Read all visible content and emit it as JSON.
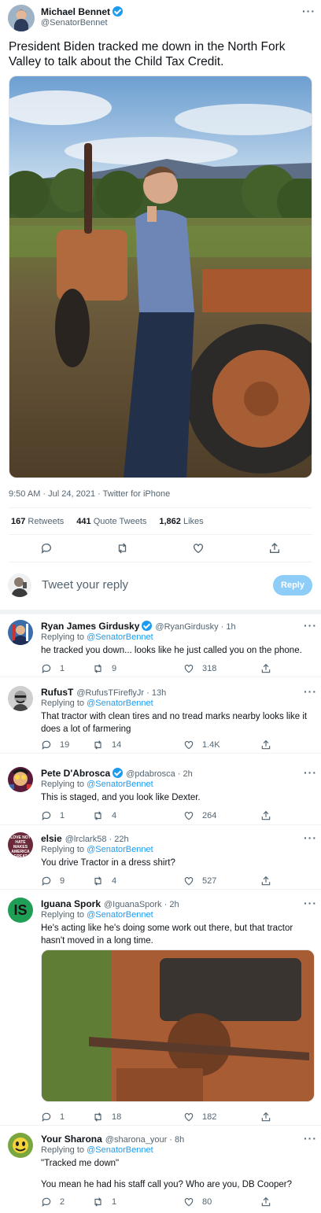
{
  "main_tweet": {
    "author_name": "Michael Bennet",
    "author_handle": "@SenatorBennet",
    "text": "President Biden tracked me down in the North Fork Valley to talk about the Child Tax Credit.",
    "timestamp": "9:50 AM · Jul 24, 2021 · Twitter for iPhone",
    "stats": {
      "retweets_count": "167",
      "retweets_label": "Retweets",
      "quotes_count": "441",
      "quotes_label": "Quote Tweets",
      "likes_count": "1,862",
      "likes_label": "Likes"
    }
  },
  "composer": {
    "placeholder": "Tweet your reply",
    "button_label": "Reply"
  },
  "replies": [
    {
      "name": "Ryan James Girdusky",
      "verified": true,
      "handle": "@RyanGirdusky · 1h",
      "replying_prefix": "Replying to",
      "replying_to": "@SenatorBennet",
      "text": "he tracked you down... looks like he just called you on the phone.",
      "replies": "1",
      "retweets": "9",
      "likes": "318"
    },
    {
      "name": "RufusT",
      "verified": false,
      "handle": "@RufusTFireflyJr · 13h",
      "replying_prefix": "Replying to",
      "replying_to": "@SenatorBennet",
      "text": "That tractor with clean tires and no tread marks nearby looks like it does a lot of farmering",
      "replies": "19",
      "retweets": "14",
      "likes": "1.4K"
    },
    {
      "name": "Pete D'Abrosca",
      "verified": true,
      "handle": "@pdabrosca · 2h",
      "replying_prefix": "Replying to",
      "replying_to": "@SenatorBennet",
      "text": "This is staged, and you look like Dexter.",
      "replies": "1",
      "retweets": "4",
      "likes": "264"
    },
    {
      "name": "elsie",
      "verified": false,
      "handle": "@lrclark58 · 22h",
      "replying_prefix": "Replying to",
      "replying_to": "@SenatorBennet",
      "text": "You drive Tractor in a dress shirt?",
      "replies": "9",
      "retweets": "4",
      "likes": "527"
    },
    {
      "name": "Iguana Spork",
      "verified": false,
      "handle": "@IguanaSpork · 2h",
      "replying_prefix": "Replying to",
      "replying_to": "@SenatorBennet",
      "text": "He's acting like he's doing some work out there, but that tractor hasn't moved in a long time.",
      "replies": "1",
      "retweets": "18",
      "likes": "182"
    },
    {
      "name": "Your Sharona",
      "verified": false,
      "handle": "@sharona_your · 8h",
      "replying_prefix": "Replying to",
      "replying_to": "@SenatorBennet",
      "text": "\"Tracked me down\"",
      "text2": "You mean he had his staff call you? Who are you, DB Cooper?",
      "replies": "2",
      "retweets": "1",
      "likes": "80"
    }
  ],
  "avatar_texts": {
    "elsie_sign": "LOVE not hate MAKES AMERICA GREAT",
    "iguana_logo": "IS"
  },
  "colors": {
    "accent": "#1d9bf0",
    "reply_button": "#8ecdf8",
    "text_secondary": "#536471",
    "divider": "#eff3f4"
  }
}
